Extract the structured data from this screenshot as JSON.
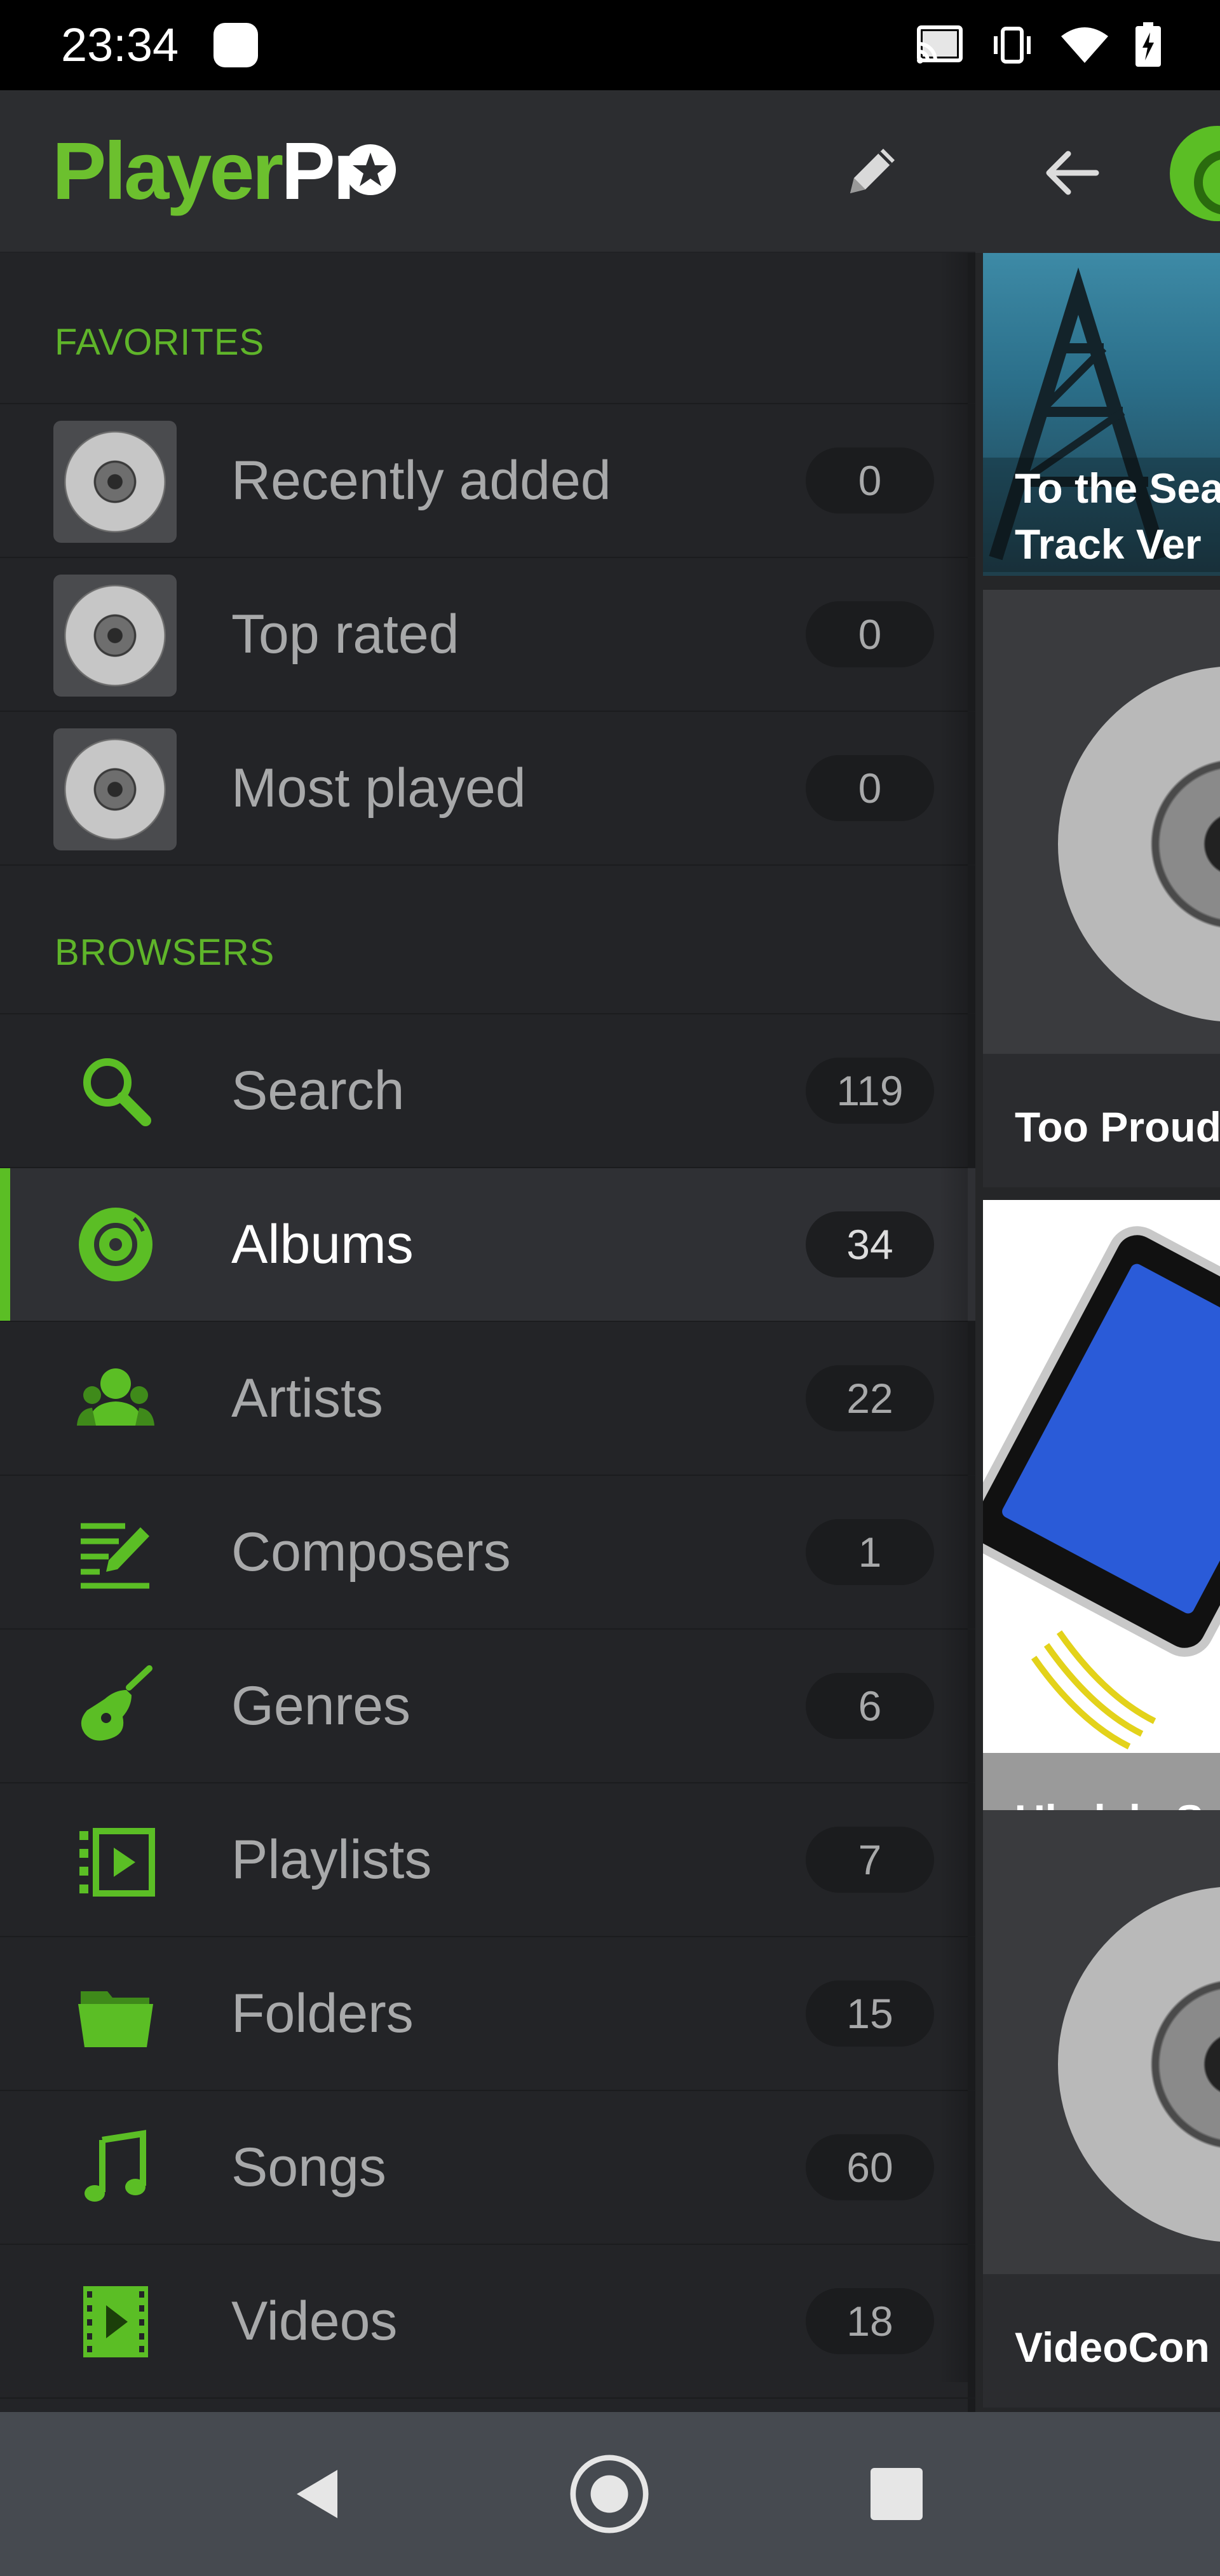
{
  "status_bar": {
    "time": "23:34",
    "icons": [
      "cast-icon",
      "vibrate-icon",
      "wifi-icon",
      "battery-charging-icon"
    ]
  },
  "drawer": {
    "logo": {
      "part1": "Player",
      "part2": "Pr"
    },
    "edit_icon": "pencil-icon",
    "sections": {
      "favorites": "FAVORITES",
      "browsers": "BROWSERS"
    },
    "favorites": [
      {
        "label": "Recently added",
        "count": "0"
      },
      {
        "label": "Top rated",
        "count": "0"
      },
      {
        "label": "Most played",
        "count": "0"
      }
    ],
    "browsers": [
      {
        "label": "Search",
        "count": "119",
        "icon": "search-icon"
      },
      {
        "label": "Albums",
        "count": "34",
        "icon": "album-icon",
        "selected": true
      },
      {
        "label": "Artists",
        "count": "22",
        "icon": "artists-icon"
      },
      {
        "label": "Composers",
        "count": "1",
        "icon": "composer-icon"
      },
      {
        "label": "Genres",
        "count": "6",
        "icon": "guitar-icon"
      },
      {
        "label": "Playlists",
        "count": "7",
        "icon": "playlist-icon"
      },
      {
        "label": "Folders",
        "count": "15",
        "icon": "folder-icon"
      },
      {
        "label": "Songs",
        "count": "60",
        "icon": "music-note-icon"
      },
      {
        "label": "Videos",
        "count": "18",
        "icon": "video-icon"
      }
    ]
  },
  "background": {
    "albums": [
      {
        "caption_line1": "To the Sea",
        "caption_line2": "Track Ver"
      },
      {
        "caption": "Too Proud"
      },
      {
        "caption": "Ukulele So"
      },
      {
        "caption": "VideoCon"
      }
    ]
  },
  "colors": {
    "accent": "#5bbe25",
    "drawer_bg": "#232427",
    "header_bg": "#2c2d30",
    "nav_bg": "#464a50"
  }
}
